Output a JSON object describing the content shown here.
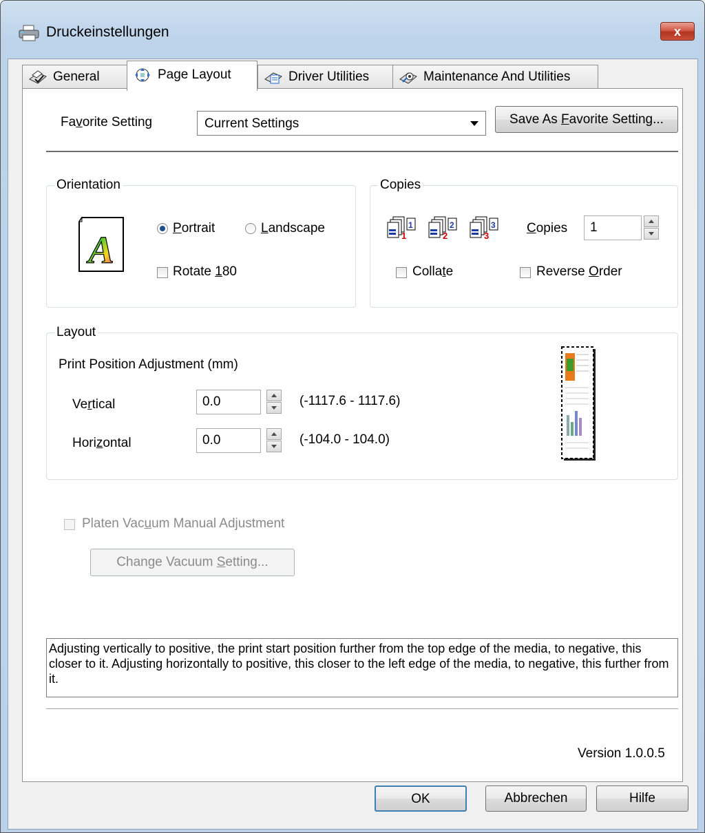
{
  "window": {
    "title": "Druckeinstellungen",
    "close_label": "x"
  },
  "tabs": [
    {
      "label": "General",
      "icon": "printer-check-icon"
    },
    {
      "label": "Page Layout",
      "icon": "page-layout-icon"
    },
    {
      "label": "Driver Utilities",
      "icon": "driver-utilities-icon"
    },
    {
      "label": "Maintenance And Utilities",
      "icon": "maintenance-icon"
    }
  ],
  "favorite": {
    "label_pre": "Fa",
    "label_u": "v",
    "label_post": "orite Setting",
    "value": "Current Settings",
    "save_pre": "Save As ",
    "save_u": "F",
    "save_post": "avorite Setting..."
  },
  "orientation": {
    "title": "Orientation",
    "portrait_u": "P",
    "portrait_post": "ortrait",
    "landscape_u": "L",
    "landscape_post": "andscape",
    "selected": "Portrait",
    "rotate_pre": "Rotate ",
    "rotate_u": "1",
    "rotate_post": "80",
    "preview_letter": "A"
  },
  "copies": {
    "title": "Copies",
    "label_u": "C",
    "label_post": "opies",
    "value": "1",
    "collate_pre": "Colla",
    "collate_u": "t",
    "collate_post": "e",
    "reverse_pre": "Reverse ",
    "reverse_u": "O",
    "reverse_post": "rder",
    "stack_icons": [
      "1",
      "2",
      "3"
    ]
  },
  "layout": {
    "title": "Layout",
    "subtitle": "Print Position Adjustment (mm)",
    "vertical_pre": "Ve",
    "vertical_u": "r",
    "vertical_post": "tical",
    "vertical_value": "0.0",
    "vertical_range": "(-1117.6 - 1117.6)",
    "horizontal_pre": "Hori",
    "horizontal_u": "z",
    "horizontal_post": "ontal",
    "horizontal_value": "0.0",
    "horizontal_range": "(-104.0 - 104.0)"
  },
  "vacuum": {
    "label_pre": "Platen Vac",
    "label_u": "u",
    "label_post": "um Manual Adjustment",
    "button_pre": "Change Vacuum ",
    "button_u": "S",
    "button_post": "etting..."
  },
  "description": "Adjusting vertically to positive, the print start position further from the top edge of the media, to negative, this closer to it. Adjusting horizontally to positive, this closer to the left edge of the media, to negative, this further from it.",
  "version": "Version 1.0.0.5",
  "buttons": {
    "ok": "OK",
    "cancel": "Abbrechen",
    "help": "Hilfe"
  },
  "colors": {
    "title_gradient_top": "#cfe0f1",
    "close_red": "#c9503a",
    "radio_dot": "#1f4e8c",
    "client_bg": "#f0f0f0"
  }
}
